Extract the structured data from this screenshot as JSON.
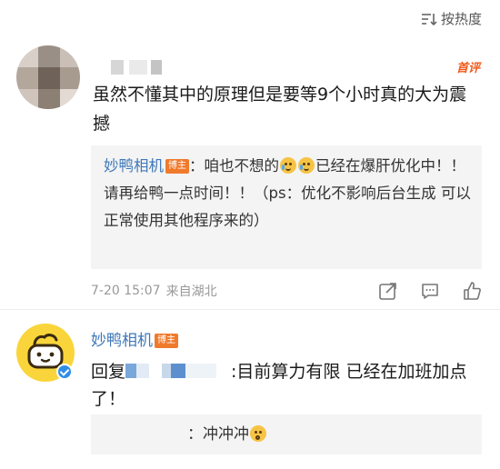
{
  "sort": {
    "label": "按热度",
    "icon": "sort-icon"
  },
  "comment": {
    "badge": "首评",
    "text": "虽然不懂其中的原理但是要等9个小时真的大为震撼",
    "reply": {
      "author": "妙鸭相机",
      "tag": "博主",
      "text_before": "：咱也不想的",
      "text_after": "已经在爆肝优化中！！请再给鸭一点时间！！（ps：优化不影响后台生成 可以正常使用其他程序来的）"
    },
    "meta": {
      "date": "7-20 15:07",
      "location": "来自湖北"
    }
  },
  "second_comment": {
    "author": "妙鸭相机",
    "tag": "博主",
    "reply_prefix": "回复",
    "text": ":目前算力有限 已经在加班加点了！",
    "bottom_text": "：冲冲冲"
  },
  "colors": {
    "link_blue": "#3f78b8",
    "badge_orange": "#f07a2c",
    "first_comment_red": "#f05a1a"
  }
}
